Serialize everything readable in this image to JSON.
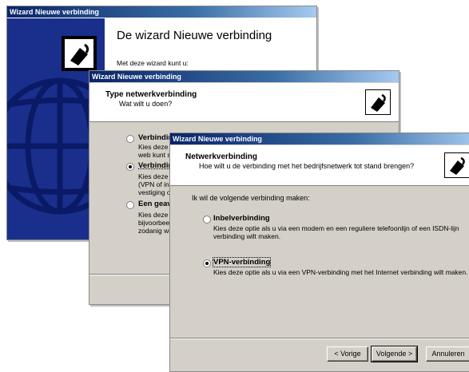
{
  "win1": {
    "title": "Wizard Nieuwe verbinding",
    "heading": "De wizard Nieuwe verbinding",
    "intro": "Met deze wizard kunt u:"
  },
  "win2": {
    "title": "Wizard Nieuwe verbinding",
    "header_title": "Type netwerkverbinding",
    "header_subtitle": "Wat wilt u doen?",
    "options": [
      {
        "label": "Verbindin",
        "desc": [
          "Kies deze c",
          "web kunt s"
        ]
      },
      {
        "label": "Verbindin",
        "desc": [
          "Kies deze c",
          "(VPN of inb",
          "vestiging of"
        ]
      },
      {
        "label": "Een geav",
        "desc": [
          "Kies deze c",
          "bijvoorbeel",
          "zodanig wilt"
        ]
      }
    ]
  },
  "win3": {
    "title": "Wizard Nieuwe verbinding",
    "header_title": "Netwerkverbinding",
    "header_subtitle": "Hoe wilt u de verbinding met het bedrijfsnetwerk tot stand brengen?",
    "prompt": "Ik wil de volgende verbinding maken:",
    "options": [
      {
        "label": "Inbelverbinding",
        "desc": "Kies deze optie als u via een modem en een reguliere telefoonlijn of een ISDN-lijn verbinding wilt maken.",
        "selected": false
      },
      {
        "label": "VPN-verbinding",
        "desc": "Kies deze optie als u via een VPN-verbinding met het Internet verbinding wilt maken.",
        "selected": true
      }
    ],
    "buttons": {
      "back": "< Vorige",
      "next": "Volgende >",
      "cancel": "Annuleren"
    }
  },
  "colors": {
    "titlebar_start": "#0a246a",
    "titlebar_end": "#a6caf0",
    "dialog_bg": "#d4d0c8",
    "globe_blue": "#1a2f8c"
  }
}
